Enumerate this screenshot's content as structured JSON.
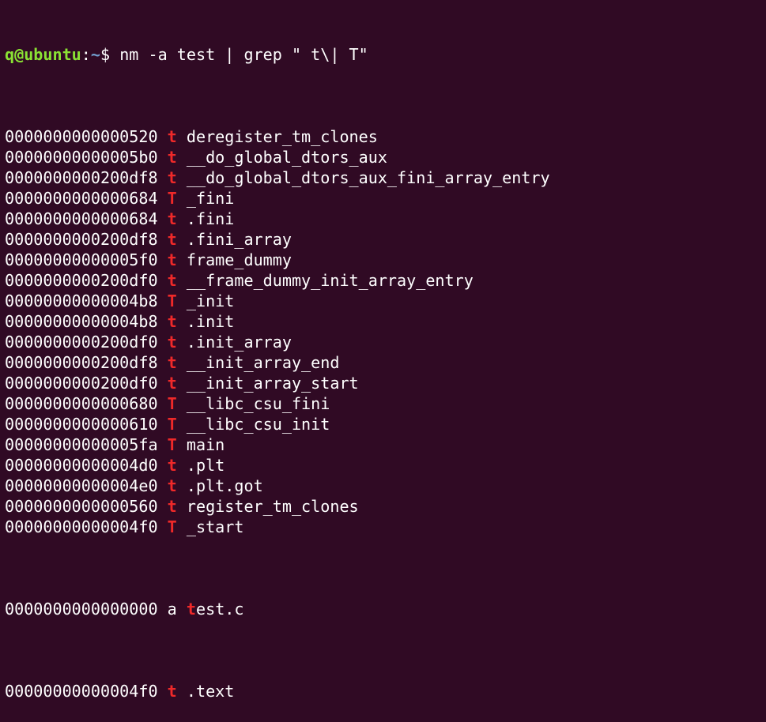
{
  "prompt": {
    "user_host": "q@ubuntu",
    "colon": ":",
    "path": "~",
    "symbol": "$ ",
    "command": "nm -a test | grep \" t\\| T\""
  },
  "output": [
    {
      "address": "0000000000000520",
      "type": "t",
      "name": "deregister_tm_clones"
    },
    {
      "address": "00000000000005b0",
      "type": "t",
      "name": "__do_global_dtors_aux"
    },
    {
      "address": "0000000000200df8",
      "type": "t",
      "name": "__do_global_dtors_aux_fini_array_entry"
    },
    {
      "address": "0000000000000684",
      "type": "T",
      "name": "_fini"
    },
    {
      "address": "0000000000000684",
      "type": "t",
      "name": ".fini"
    },
    {
      "address": "0000000000200df8",
      "type": "t",
      "name": ".fini_array"
    },
    {
      "address": "00000000000005f0",
      "type": "t",
      "name": "frame_dummy"
    },
    {
      "address": "0000000000200df0",
      "type": "t",
      "name": "__frame_dummy_init_array_entry"
    },
    {
      "address": "00000000000004b8",
      "type": "T",
      "name": "_init"
    },
    {
      "address": "00000000000004b8",
      "type": "t",
      "name": ".init"
    },
    {
      "address": "0000000000200df0",
      "type": "t",
      "name": ".init_array"
    },
    {
      "address": "0000000000200df8",
      "type": "t",
      "name": "__init_array_end"
    },
    {
      "address": "0000000000200df0",
      "type": "t",
      "name": "__init_array_start"
    },
    {
      "address": "0000000000000680",
      "type": "T",
      "name": "__libc_csu_fini"
    },
    {
      "address": "0000000000000610",
      "type": "T",
      "name": "__libc_csu_init"
    },
    {
      "address": "00000000000005fa",
      "type": "T",
      "name": "main"
    },
    {
      "address": "00000000000004d0",
      "type": "t",
      "name": ".plt"
    },
    {
      "address": "00000000000004e0",
      "type": "t",
      "name": ".plt.got"
    },
    {
      "address": "0000000000000560",
      "type": "t",
      "name": "register_tm_clones"
    },
    {
      "address": "00000000000004f0",
      "type": "T",
      "name": "_start"
    }
  ],
  "abs_line": {
    "address": "0000000000000000",
    "type": "a",
    "name_highlight": "t",
    "name_rest": "est.c"
  },
  "last_line": {
    "address": "00000000000004f0",
    "type": "t",
    "name": ".text"
  },
  "colors": {
    "background": "#300a24",
    "text": "#ffffff",
    "prompt_user": "#8ae234",
    "prompt_path": "#729fcf",
    "match_highlight": "#ef2929"
  }
}
